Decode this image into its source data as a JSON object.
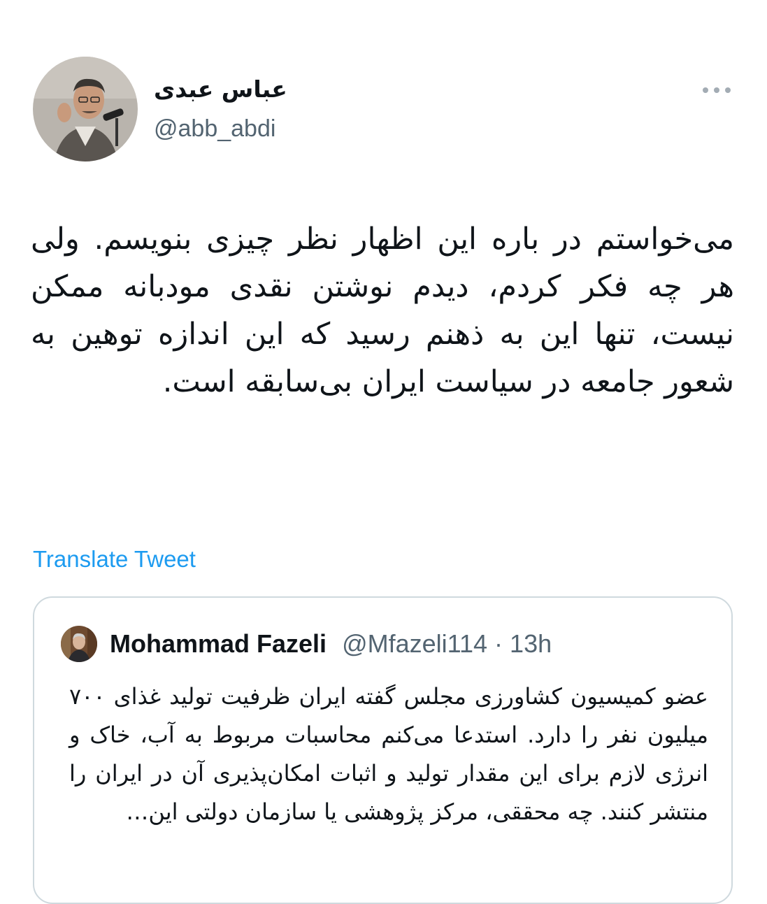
{
  "tweet": {
    "author_name": "عباس عبدی",
    "author_handle": "@abb_abdi",
    "more_icon": "more-horizontal-icon",
    "text": "می‌خواستم در باره این اظهار نظر چیزی بنویسم. ولی هر چه فکر کردم، دیدم نوشتن نقدی مودبانه ممکن نیست، تنها این به ذهنم رسید که این اندازه توهین به شعور جامعه در سیاست ایران بی‌سابقه است.",
    "translate_label": "Translate Tweet"
  },
  "quote": {
    "name": "Mohammad Fazeli",
    "handle": "@Mfazeli114",
    "separator": " · ",
    "time": "13h",
    "text": "عضو کمیسیون کشاورزی مجلس گفته ایران ظرفیت تولید غذای ۷۰۰ میلیون نفر را دارد. استدعا می‌کنم محاسبات مربوط به آب، خاک و انرژی لازم برای این مقدار تولید و اثبات امکان‌پذیری آن در ایران را منتشر کنند. چه محققی، مرکز پژوهشی یا سازمان دولتی این…"
  },
  "colors": {
    "link": "#1d9bf0",
    "secondary_text": "#536471",
    "border": "#cfd9de",
    "primary_text": "#0f1419"
  }
}
